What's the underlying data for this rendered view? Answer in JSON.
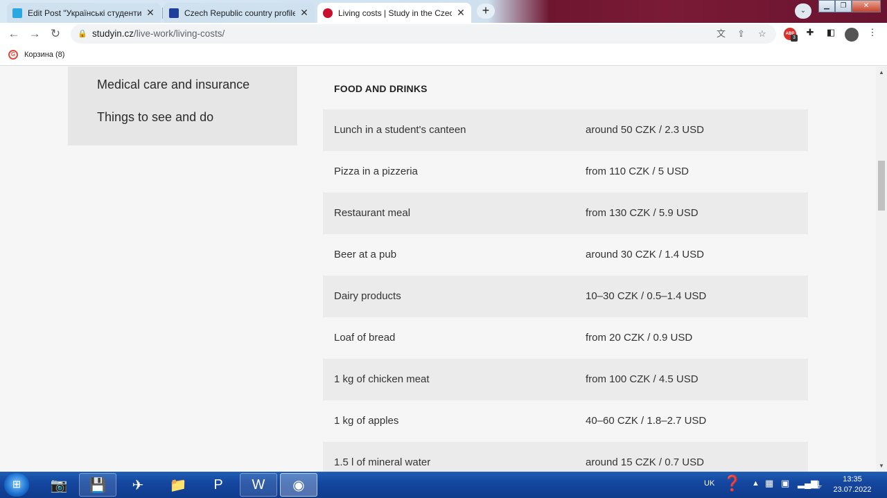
{
  "browser": {
    "tabs": [
      {
        "title": "Edit Post \"Українські студенти за",
        "favicon": "u-icon",
        "favicon_color": "#2aa8e0",
        "active": false
      },
      {
        "title": "Czech Republic country profile | E",
        "favicon": "eu-flag-icon",
        "favicon_color": "#1d3f9a",
        "active": false
      },
      {
        "title": "Living costs | Study in the Czech R",
        "favicon": "studyin-icon",
        "favicon_color": "#c8102e",
        "active": true
      }
    ],
    "new_tab_label": "+",
    "url": {
      "domain": "studyin.cz",
      "path": "/live-work/living-costs/"
    },
    "bookmarks": [
      {
        "label": "Корзина (8)",
        "icon": "g-icon"
      }
    ],
    "extension_badge": "3",
    "window_buttons": [
      "minimize",
      "maximize",
      "close"
    ]
  },
  "page": {
    "sidebar_links": [
      "Medical care and insurance",
      "Things to see and do"
    ],
    "section_title": "FOOD AND DRINKS",
    "rows": [
      {
        "item": "Lunch in a student's canteen",
        "price": "around 50 CZK / 2.3 USD"
      },
      {
        "item": "Pizza in a pizzeria",
        "price": "from 110 CZK / 5 USD"
      },
      {
        "item": "Restaurant meal",
        "price": "from 130 CZK / 5.9 USD"
      },
      {
        "item": "Beer at a pub",
        "price": "around 30 CZK / 1.4 USD"
      },
      {
        "item": "Dairy products",
        "price": "10–30 CZK / 0.5–1.4 USD"
      },
      {
        "item": "Loaf of bread",
        "price": "from 20 CZK / 0.9 USD"
      },
      {
        "item": "1 kg of chicken meat",
        "price": "from 100 CZK / 4.5 USD"
      },
      {
        "item": "1 kg of apples",
        "price": "40–60 CZK / 1.8–2.7 USD"
      },
      {
        "item": "1.5 l of mineral water",
        "price": "around 15 CZK / 0.7 USD"
      }
    ]
  },
  "taskbar": {
    "apps": [
      "camera-icon",
      "save-floppy-icon",
      "telegram-icon",
      "file-explorer-icon",
      "powerpoint-icon",
      "word-icon",
      "chrome-icon"
    ],
    "language": "UK",
    "time": "13:35",
    "date": "23.07.2022"
  },
  "colors": {
    "accent": "#1a73e8",
    "row_shade": "#ebebeb",
    "sidebar_bg": "#e6e6e6",
    "page_bg": "#f6f6f6"
  }
}
